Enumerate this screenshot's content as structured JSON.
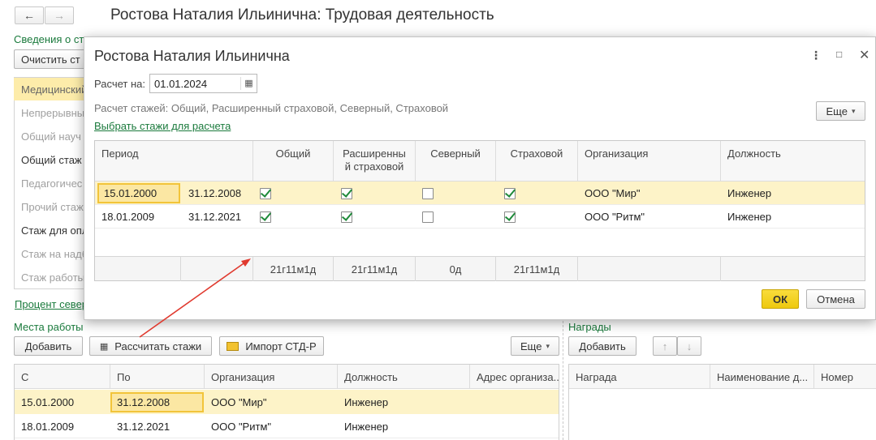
{
  "window": {
    "title": "Ростова Наталия Ильинична: Трудовая деятельность",
    "section_label": "Сведения о ст",
    "clear_button": "Очистить ст",
    "side_items": [
      {
        "label": "Медицинский",
        "selected": true
      },
      {
        "label": "Непрерывны"
      },
      {
        "label": "Общий науч"
      },
      {
        "label": "Общий стаж",
        "dark": true
      },
      {
        "label": "Педагогичес"
      },
      {
        "label": "Прочий стаж"
      },
      {
        "label": "Стаж для опл",
        "dark": true
      },
      {
        "label": "Стаж на надб"
      },
      {
        "label": "Стаж работы"
      }
    ],
    "percent_link": "Процент север"
  },
  "work_places": {
    "title": "Места работы",
    "add_button": "Добавить",
    "calc_button": "Рассчитать стажи",
    "import_button": "Импорт СТД-Р",
    "more_button": "Еще",
    "columns": [
      "С",
      "По",
      "Организация",
      "Должность",
      "Адрес организа..."
    ],
    "rows": [
      {
        "from": "15.01.2000",
        "to": "31.12.2008",
        "org": "ООО \"Мир\"",
        "position": "Инженер"
      },
      {
        "from": "18.01.2009",
        "to": "31.12.2021",
        "org": "ООО \"Ритм\"",
        "position": "Инженер"
      }
    ]
  },
  "awards": {
    "title": "Награды",
    "add_button": "Добавить",
    "columns": [
      "Награда",
      "Наименование д...",
      "Номер"
    ]
  },
  "dialog": {
    "title": "Ростова Наталия Ильинична",
    "calc_on_label": "Расчет на:",
    "calc_on_value": "01.01.2024",
    "info_text": "Расчет стажей: Общий, Расширенный страховой, Северный, Страховой",
    "choose_link": "Выбрать стажи для расчета",
    "more_button": "Еще",
    "columns": {
      "period": "Период",
      "general": "Общий",
      "extended": "Расширенны й страховой",
      "north": "Северный",
      "insurance": "Страховой",
      "org": "Организация",
      "position": "Должность"
    },
    "rows": [
      {
        "from": "15.01.2000",
        "to": "31.12.2008",
        "general": true,
        "extended": true,
        "north": false,
        "insurance": true,
        "org": "ООО \"Мир\"",
        "position": "Инженер"
      },
      {
        "from": "18.01.2009",
        "to": "31.12.2021",
        "general": true,
        "extended": true,
        "north": false,
        "insurance": true,
        "org": "ООО \"Ритм\"",
        "position": "Инженер"
      }
    ],
    "totals": {
      "general": "21г11м1д",
      "extended": "21г11м1д",
      "north": "0д",
      "insurance": "21г11м1д"
    },
    "ok_button": "ОК",
    "cancel_button": "Отмена"
  },
  "colors": {
    "accent_yellow": "#f5d40f",
    "selected_row": "#fdf3c8",
    "link_green": "#1a7a3c",
    "arrow_red": "#e03a2f"
  }
}
